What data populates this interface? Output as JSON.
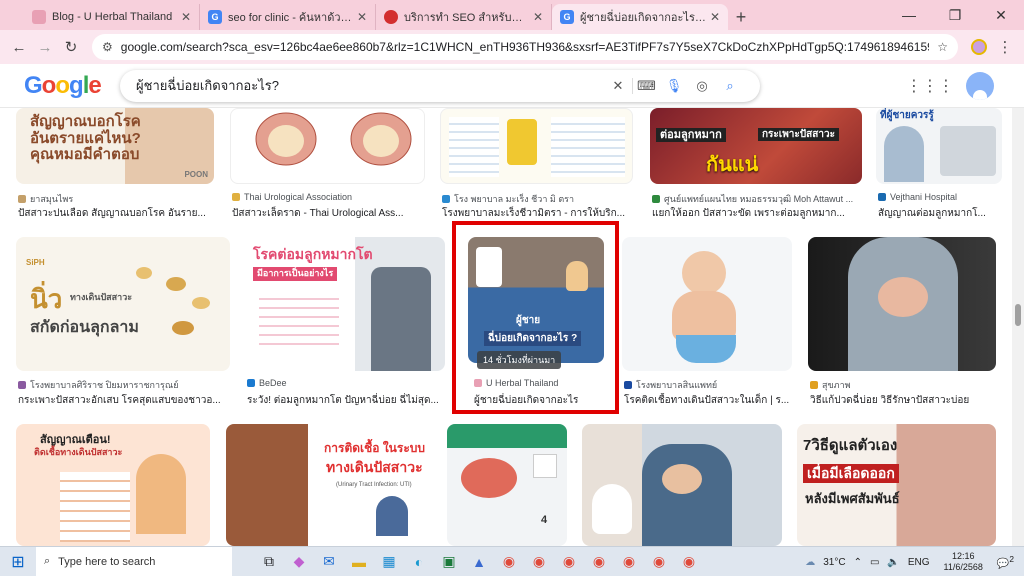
{
  "tabs": [
    {
      "title": "Blog - U Herbal Thailand",
      "fav_color": "#e8a0b4",
      "fav_text": ""
    },
    {
      "title": "seo for clinic - ค้นหาด้วย Google",
      "fav_color": "#4285f4",
      "fav_text": "G"
    },
    {
      "title": "บริการทำ SEO สำหรับคลินิกเสริมความงาม",
      "fav_color": "#d32f2f",
      "fav_text": ""
    },
    {
      "title": "ผู้ชายฉี่บ่อยเกิดจากอะไร? - ค้นหาด้วย Google",
      "fav_color": "#4285f4",
      "fav_text": "G",
      "active": true
    }
  ],
  "address": "google.com/search?sca_esv=126bc4ae6ee860b7&rlz=1C1WHCN_enTH936TH936&sxsrf=AE3TifPF7s7Y5seX7CkDoCzhXPpHdTgp5Q:1749618946159&q=ผู้ชายฉี่บ่อยเกิดจากอะไร...",
  "query": "ผู้ชายฉี่บ่อยเกิดจากอะไร?",
  "logo": {
    "l1": "G",
    "l2": "o",
    "l3": "o",
    "l4": "g",
    "l5": "l",
    "l6": "e"
  },
  "row1": [
    {
      "source": "ยาสมุนไพร",
      "title": "ปัสสาวะปนเลือด สัญญาณบอกโรค อันราย...",
      "cap": "สัญญาณบอกโรค อันตรายแค่ไหน? คุณหมอมีคำตอบ",
      "brand": "POON"
    },
    {
      "source": "Thai Urological Association",
      "title": "ปัสสาวะเล็ดราด - Thai Urological Ass..."
    },
    {
      "source": "โรง พยาบาล มะเร็ง ชีวา มิ ตรา",
      "title": "โรงพยาบาลมะเร็งชีวามิตรา - การให้บริก..."
    },
    {
      "source": "ศูนย์แพทย์แผนไทย หมอธรรมวุฒิ Moh Attawut ...",
      "title": "แยกให้ออก ปัสสาวะขัด เพราะต่อมลูกหมาก...",
      "cap": "กันแน่",
      "cap2": "ต่อมลูกหมาก",
      "cap3": "กระเพาะปัสสาวะ"
    },
    {
      "source": "Vejthani Hospital",
      "title": "สัญญาณต่อมลูกหมากโ...",
      "cap": "ที่ผู้ชายควรรู้"
    }
  ],
  "row2": [
    {
      "source": "โรงพยาบาลศิริราช ปิยมหาราชการุณย์",
      "title": "กระเพาะปัสสาวะอักเสบ โรคสุดแสบของชาวอ...",
      "cap": "นิ่ว",
      "cap2": "ทางเดินปัสสาวะ",
      "cap3": "สกัดก่อนลุกลาม",
      "logo": "SiPH"
    },
    {
      "source": "BeDee",
      "title": "ระวัง! ต่อมลูกหมากโต ปัญหาฉี่บ่อย ฉี่ไม่สุด...",
      "cap": "โรคต่อมลูกหมากโต",
      "cap2": "มีอาการเป็นอย่างไร"
    },
    {
      "source": "U Herbal Thailand",
      "title": "ผู้ชายฉี่บ่อยเกิดจากอะไร",
      "cap": "ผู้ชาย",
      "cap2": "ฉี่บ่อยเกิดจากอะไร ?"
    },
    {
      "source": "โรงพยาบาลสินแพทย์",
      "title": "โรคติดเชื้อทางเดินปัสสาวะในเด็ก | ร..."
    },
    {
      "source": "สุขภาพ",
      "title": "วิธีแก้ปวดฉี่บ่อย วิธีรักษาปัสสาวะบ่อย"
    }
  ],
  "row3": [
    {
      "cap": "สัญญาณเตือน!",
      "cap2": "ติดเชื้อทางเดินปัสสาวะ"
    },
    {
      "cap": "การติดเชื้อ ในระบบ",
      "cap2": "ทางเดินปัสสาวะ",
      "cap3": "(Urinary Tract Infection: UTI)"
    },
    {
      "cap": "4"
    },
    {},
    {
      "cap": "7วิธีดูแลตัวเอง",
      "cap2": "เมื่อมีเลือดออก",
      "cap3": "หลังมีเพศสัมพันธ์"
    }
  ],
  "hover_badge": "14 ชั่วโมงที่ผ่านมา",
  "taskbar": {
    "search_placeholder": "Type here to search",
    "weather": "31°C",
    "lang": "ENG",
    "time": "12:16",
    "date": "11/6/2568",
    "notif": "2"
  },
  "colors": {
    "highlight": "#e00000",
    "tabstrip": "#f7d0dc",
    "toolbar": "#fbe7ef"
  }
}
